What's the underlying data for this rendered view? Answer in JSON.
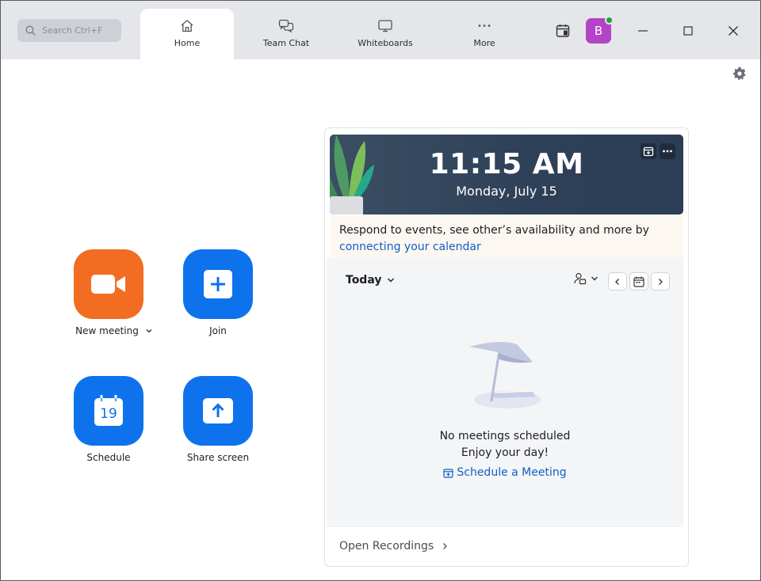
{
  "search": {
    "placeholder": "Search Ctrl+F"
  },
  "tabs": [
    {
      "label": "Home",
      "icon": "home-icon",
      "active": true
    },
    {
      "label": "Team Chat",
      "icon": "chat-icon",
      "active": false
    },
    {
      "label": "Whiteboards",
      "icon": "whiteboard-icon",
      "active": false
    },
    {
      "label": "More",
      "icon": "more-dots-icon",
      "active": false
    }
  ],
  "user": {
    "initial": "B",
    "avatar_color": "#b344c7",
    "status_color": "#1fa33a"
  },
  "actions": {
    "new_meeting": "New meeting",
    "join": "Join",
    "schedule": "Schedule",
    "schedule_day": "19",
    "share_screen": "Share screen"
  },
  "colors": {
    "accent_blue": "#0e72ed",
    "accent_orange": "#f26d21",
    "hero_bg": "#2e4057"
  },
  "hero": {
    "time": "11:15 AM",
    "date": "Monday, July 15"
  },
  "calendar_notice": {
    "text": "Respond to events, see other’s availability and more by",
    "link": "connecting your calendar"
  },
  "meetings": {
    "day_filter": "Today",
    "empty_title": "No meetings scheduled",
    "empty_subtitle": "Enjoy your day!",
    "schedule_link": "Schedule a Meeting"
  },
  "footer": {
    "open_recordings": "Open Recordings"
  }
}
